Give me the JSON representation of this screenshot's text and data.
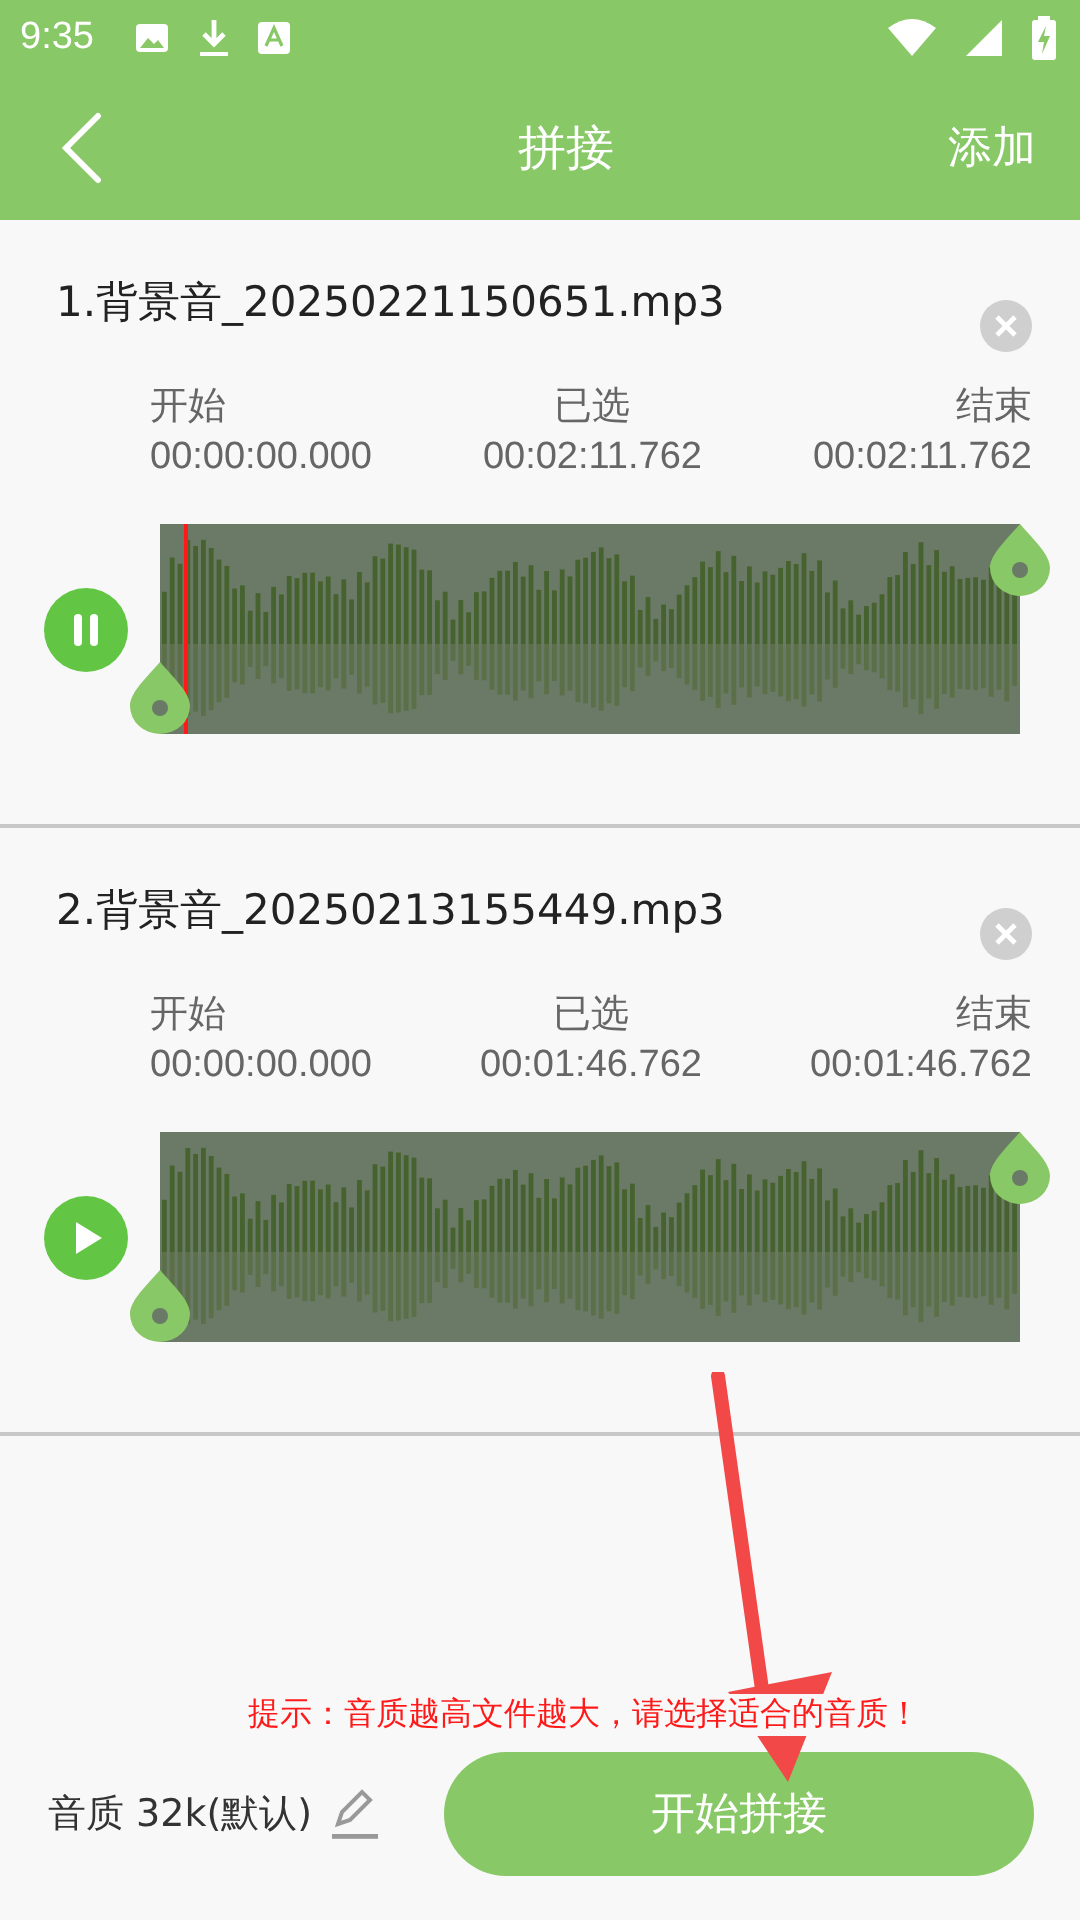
{
  "status_bar": {
    "time": "9:35"
  },
  "app_bar": {
    "title": "拼接",
    "action": "添加"
  },
  "clips": [
    {
      "title": "1.背景音_20250221150651.mp3",
      "start_label": "开始",
      "start": "00:00:00.000",
      "selected_label": "已选",
      "selected": "00:02:11.762",
      "end_label": "结束",
      "end": "00:02:11.762",
      "playing": true
    },
    {
      "title": "2.背景音_20250213155449.mp3",
      "start_label": "开始",
      "start": "00:00:00.000",
      "selected_label": "已选",
      "selected": "00:01:46.762",
      "end_label": "结束",
      "end": "00:01:46.762",
      "playing": false
    }
  ],
  "hint": "提示：音质越高文件越大，请选择适合的音质！",
  "quality": "音质 32k(默认)",
  "start_button": "开始拼接"
}
